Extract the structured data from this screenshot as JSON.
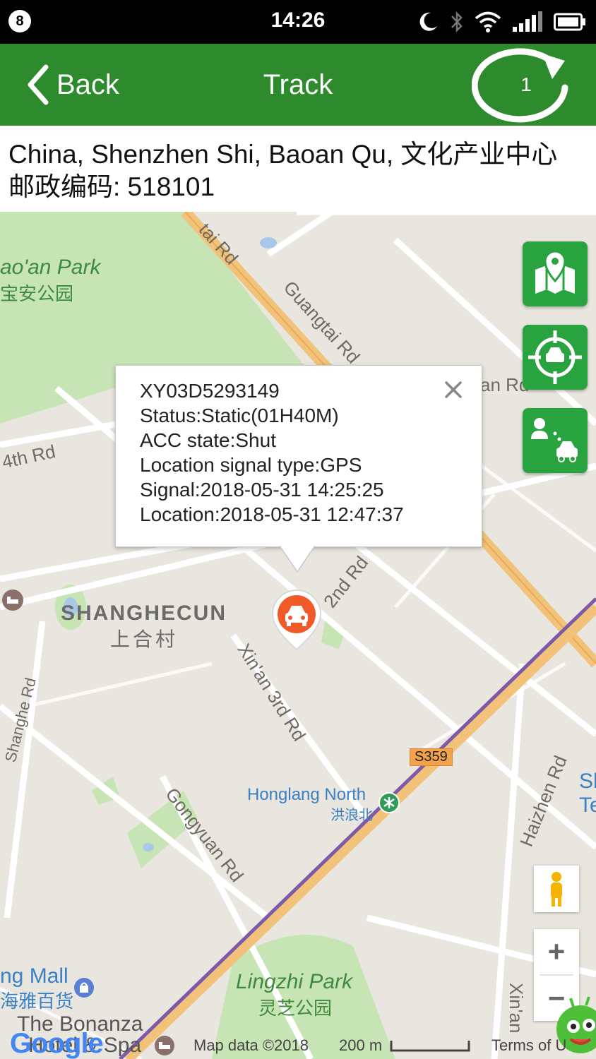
{
  "status_bar": {
    "notification_badge": "8",
    "time": "14:26"
  },
  "nav": {
    "back_label": "Back",
    "title": "Track",
    "refresh_count": "1"
  },
  "address": {
    "line1": "China, Shenzhen Shi, Baoan Qu, 文化产业中心",
    "line2": "邮政编码: 518101"
  },
  "map": {
    "labels": {
      "park_nw_en": "ao'an Park",
      "park_nw_zh": "宝安公园",
      "road_guangtai_top": "tai Rd",
      "road_guangtai": "Guangtai Rd",
      "road_an": "an Rd",
      "road_4th": "4th Rd",
      "district_en": "SHANGHECUN",
      "district_zh": "上合村",
      "road_2nd": "2nd Rd",
      "road_xinan_3rd": "Xin'an 3rd Rd",
      "road_shanghe": "Shanghe Rd",
      "highway": "S359",
      "station_en": "Honglang North",
      "station_zh": "洪浪北",
      "road_haizhen": "Haizhen Rd",
      "road_gongyuan": "Gongyuan Rd",
      "edge_si": "Sl",
      "edge_te": "Te",
      "mall_en": "ng Mall",
      "mall_zh": "海雅百货",
      "hotel_1": "The Bonanza",
      "hotel_2": "Hotel & Spa",
      "park_s_en": "Lingzhi Park",
      "park_s_zh": "灵芝公园",
      "road_xinan": "Xin'an"
    },
    "popup": {
      "device_id": "XY03D5293149",
      "status": "Status:Static(01H40M)",
      "acc": "ACC state:Shut",
      "signal_type": "Location signal type:GPS",
      "signal_time": "Signal:2018-05-31 14:25:25",
      "location_time": "Location:2018-05-31 12:47:37"
    },
    "controls": {
      "zoom_in": "+",
      "zoom_out": "−"
    },
    "footer": {
      "logo": "Google",
      "map_data": "Map data ©2018",
      "scale": "200 m",
      "terms": "Terms of U"
    }
  },
  "colors": {
    "nav_green": "#2d8a2d",
    "fab_green": "#29a33f",
    "marker_orange": "#f05a28",
    "park_green": "#c6e4b4",
    "road_orange": "#f2c27a",
    "metro_purple": "#7d5aa8"
  }
}
